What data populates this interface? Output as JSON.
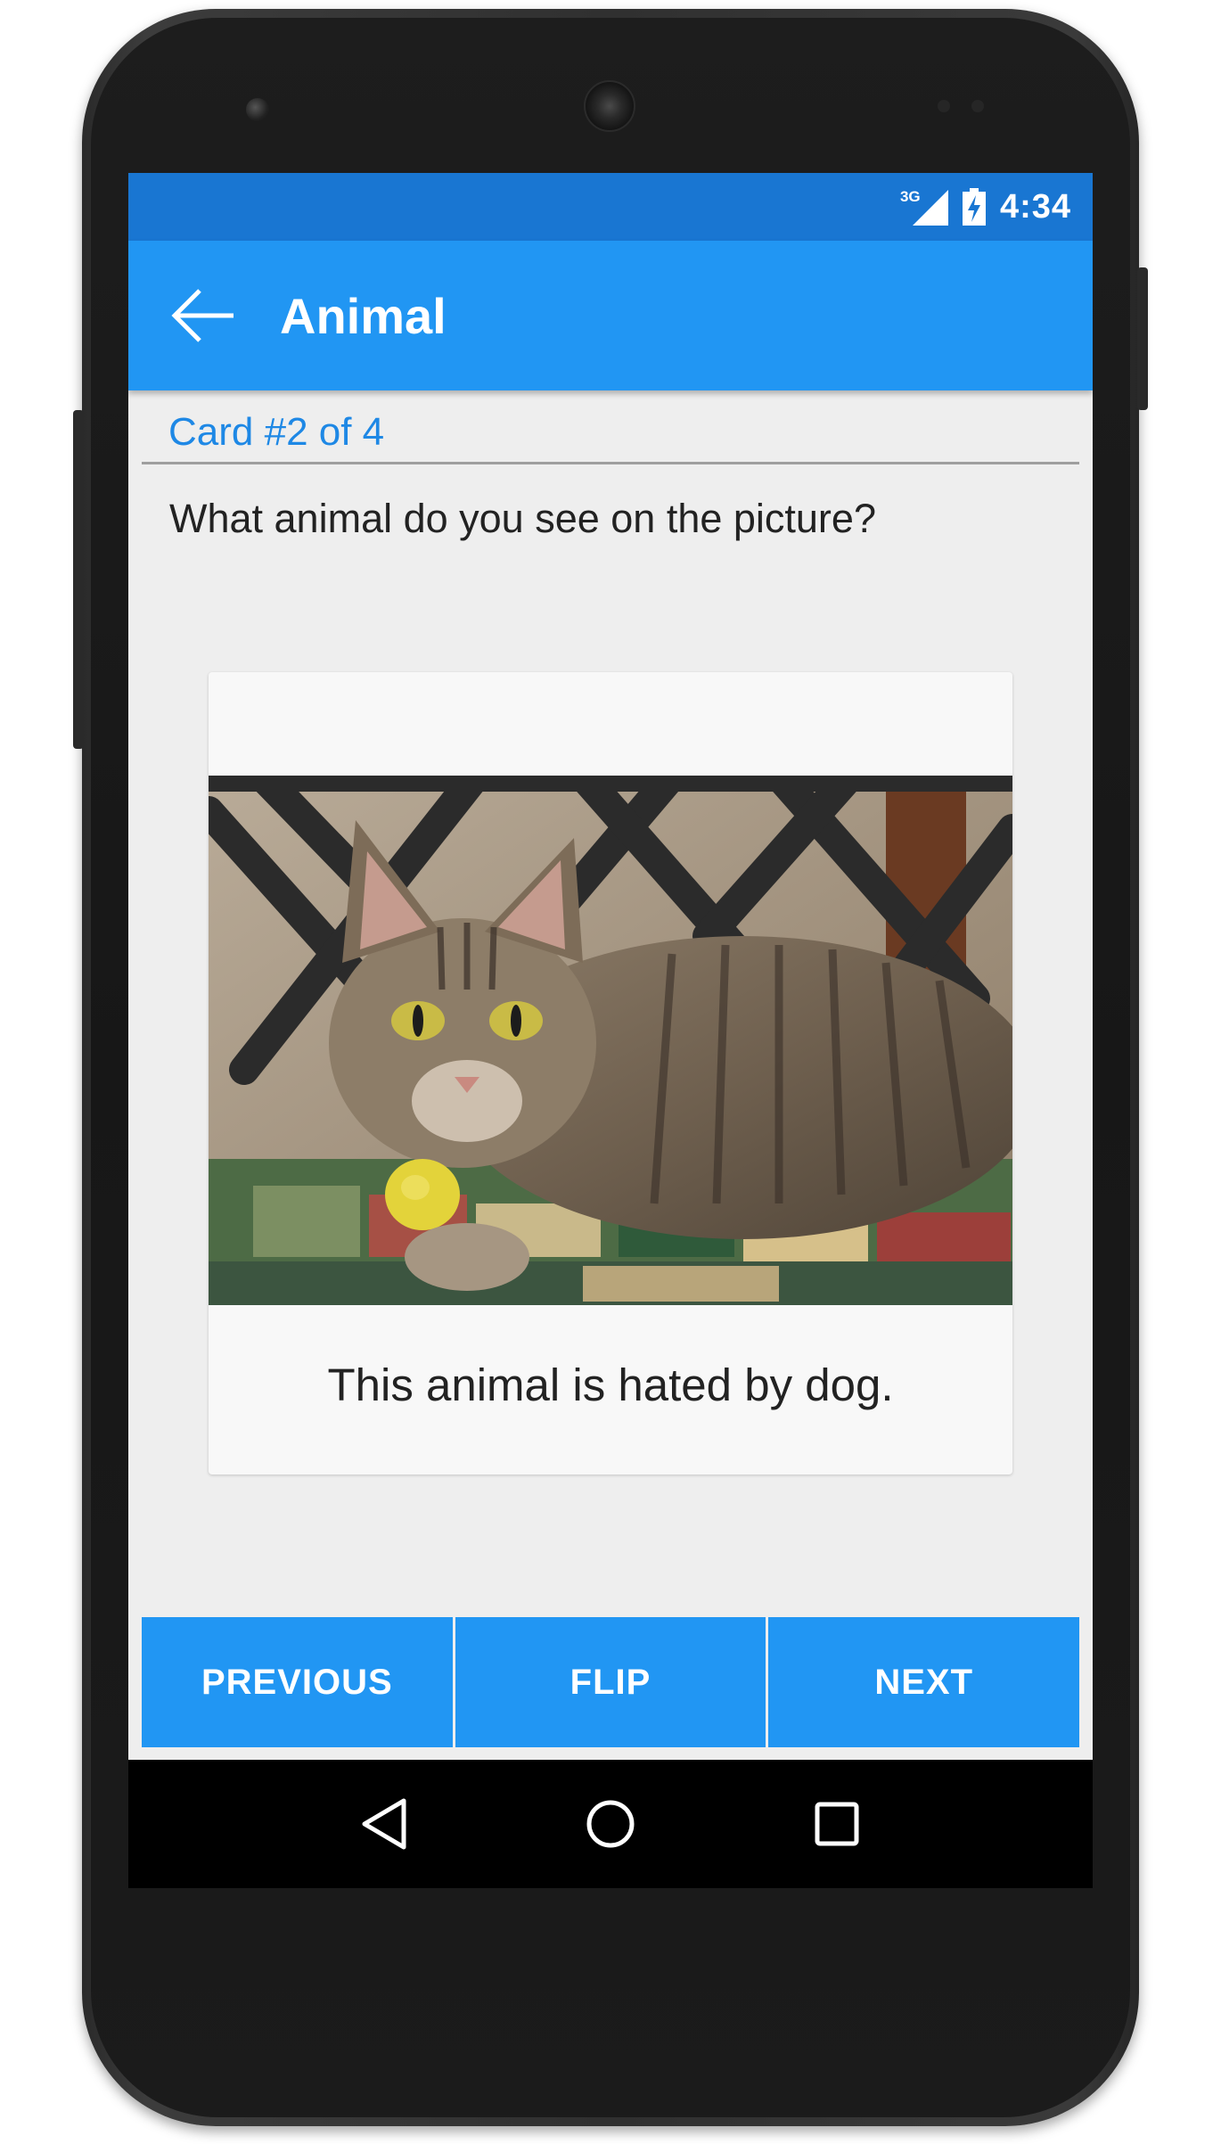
{
  "status_bar": {
    "network_label": "3G",
    "time": "4:34"
  },
  "app_bar": {
    "title": "Animal",
    "back_icon": "arrow-left-icon"
  },
  "card": {
    "counter": "Card #2 of 4",
    "question": "What animal do you see on the picture?",
    "image_subject": "tabby cat lying on a patchwork cushion",
    "hint": "This animal is hated by dog."
  },
  "buttons": {
    "previous": "PREVIOUS",
    "flip": "FLIP",
    "next": "NEXT"
  },
  "nav_bar": {
    "back_icon": "triangle-back-icon",
    "home_icon": "circle-home-icon",
    "recents_icon": "square-recents-icon"
  },
  "colors": {
    "status_bar": "#1976d2",
    "app_bar": "#2196f3",
    "accent_text": "#1e88e5",
    "button": "#2196f3",
    "background": "#eeeeee"
  }
}
